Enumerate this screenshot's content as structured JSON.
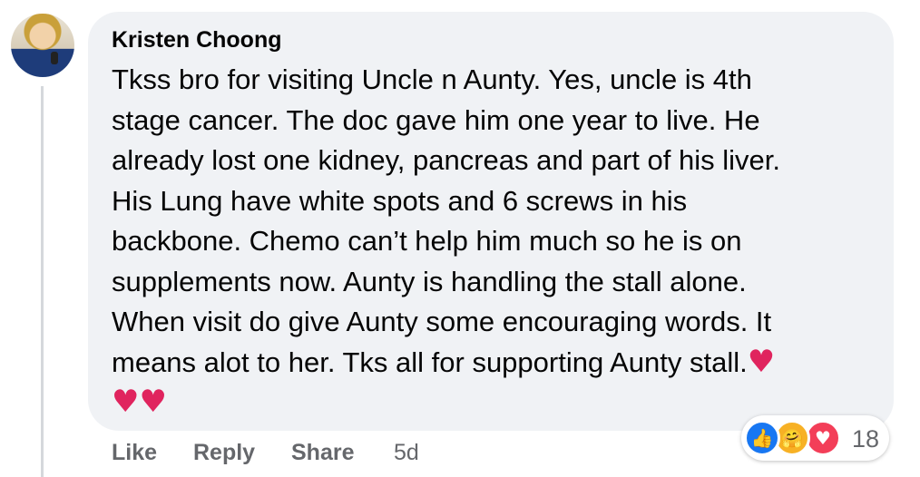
{
  "comment": {
    "author": "Kristen Choong",
    "text": "Tkss bro for visiting Uncle n Aunty. Yes, uncle is 4th\nstage cancer. The doc gave him one year to live. He\nalready lost one kidney, pancreas and part of his liver.\nHis Lung have white spots and 6 screws in his\nbackbone. Chemo can’t help him much so he is on\nsupplements now. Aunty is handling the stall alone.\nWhen visit do give Aunty some encouraging words. It\nmeans alot to her. Tks all for supporting Aunty stall.",
    "emoji_inline": "♥",
    "emoji_line": "♥♥"
  },
  "reactions": {
    "icons": [
      "like-icon",
      "care-icon",
      "love-icon"
    ],
    "like_glyph": "👍",
    "care_glyph": "🤗",
    "love_glyph": "♥",
    "count": "18"
  },
  "actions": {
    "like": "Like",
    "reply": "Reply",
    "share": "Share",
    "time": "5d"
  },
  "colors": {
    "bubble": "#f0f2f5",
    "text": "#050505",
    "meta": "#65676b",
    "like_blue": "#1877f2",
    "heart_red": "#e0245e"
  }
}
